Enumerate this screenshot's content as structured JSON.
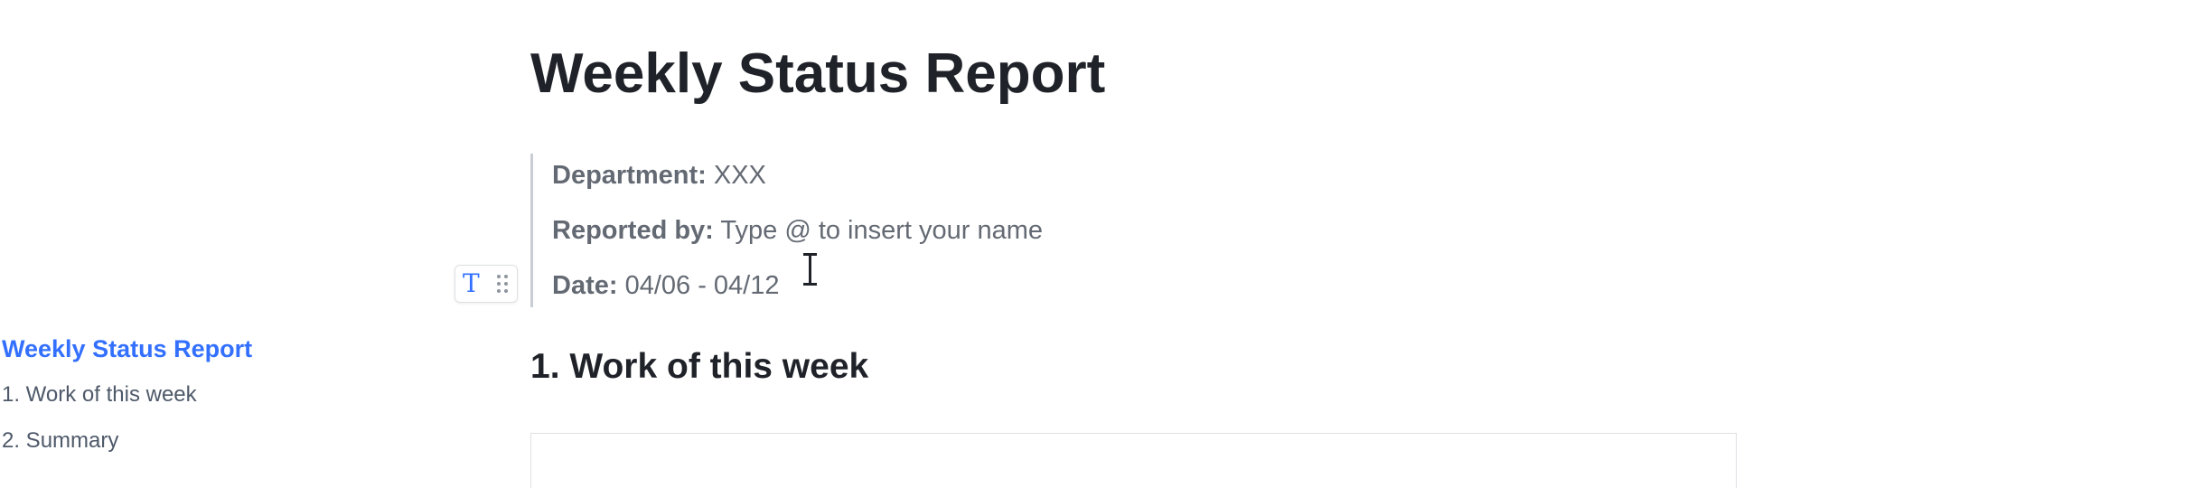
{
  "outline": {
    "items": [
      {
        "label": "Weekly Status Report",
        "active": true
      },
      {
        "label": "1. Work of this week",
        "active": false
      },
      {
        "label": "2. Summary",
        "active": false
      }
    ]
  },
  "document": {
    "title": "Weekly Status Report",
    "info": {
      "department_label": "Department:",
      "department_value": "XXX",
      "reported_by_label": "Reported by:",
      "reported_by_placeholder": "Type @ to insert your name",
      "date_label": "Date:",
      "date_value": "04/06 - 04/12"
    },
    "section1_heading": "1. Work of this week"
  },
  "block_handle": {
    "type_icon": "text-type-icon",
    "drag_icon": "drag-handle-icon"
  },
  "colors": {
    "accent": "#3370ff",
    "text": "#1f2329",
    "muted": "#646a73"
  }
}
